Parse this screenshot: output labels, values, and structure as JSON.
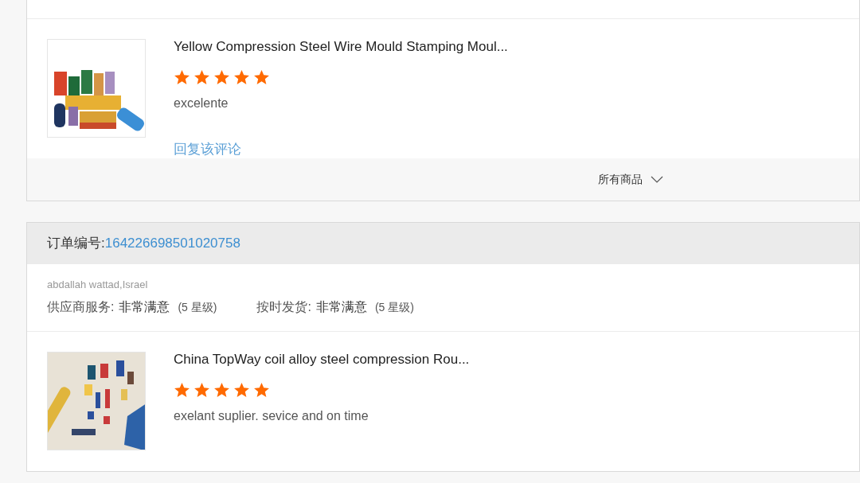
{
  "orders": [
    {
      "reviews": [
        {
          "title": "Yellow Compression Steel Wire Mould Stamping Moul...",
          "stars": 5,
          "comment": "excelente",
          "reply_link": "回复该评论"
        }
      ],
      "footer": {
        "label": "所有商品",
        "expanded": false
      }
    },
    {
      "order_label": "订单编号:",
      "order_number": "164226698501020758",
      "buyer": "abdallah wattad,Israel",
      "ratings": [
        {
          "label": "供应商服务:",
          "value": "非常满意",
          "level_text": "(5 星级)"
        },
        {
          "label": "按时发货:",
          "value": "非常满意",
          "level_text": "(5 星级)"
        }
      ],
      "reviews": [
        {
          "title": "China TopWay coil alloy steel compression Rou...",
          "stars": 5,
          "comment": "exelant suplier. sevice and on time"
        }
      ]
    }
  ]
}
